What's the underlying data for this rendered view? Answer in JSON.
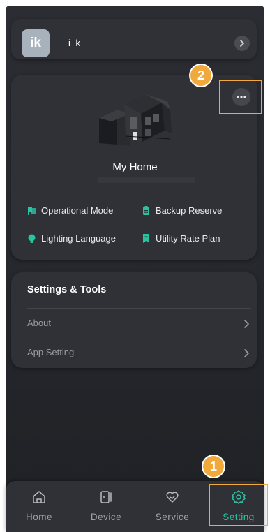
{
  "profile": {
    "avatar_initials": "ik",
    "username": "i k"
  },
  "home": {
    "title": "My Home",
    "features": [
      {
        "label": "Operational Mode",
        "icon": "flag-icon"
      },
      {
        "label": "Backup Reserve",
        "icon": "battery-icon"
      },
      {
        "label": "Lighting Language",
        "icon": "bulb-icon"
      },
      {
        "label": "Utility Rate Plan",
        "icon": "bookmark-icon"
      }
    ]
  },
  "settings": {
    "title": "Settings & Tools",
    "items": [
      {
        "label": "About"
      },
      {
        "label": "App Setting"
      }
    ]
  },
  "annotations": {
    "marker_1": "1",
    "marker_2": "2"
  },
  "tabbar": {
    "tabs": [
      {
        "label": "Home",
        "icon": "home-icon"
      },
      {
        "label": "Device",
        "icon": "device-icon"
      },
      {
        "label": "Service",
        "icon": "service-icon"
      },
      {
        "label": "Setting",
        "icon": "settings-gear-icon",
        "active": true
      }
    ]
  },
  "colors": {
    "accent": "#28c4a2",
    "highlight": "#f2a93b",
    "background": "#2b2d33"
  }
}
